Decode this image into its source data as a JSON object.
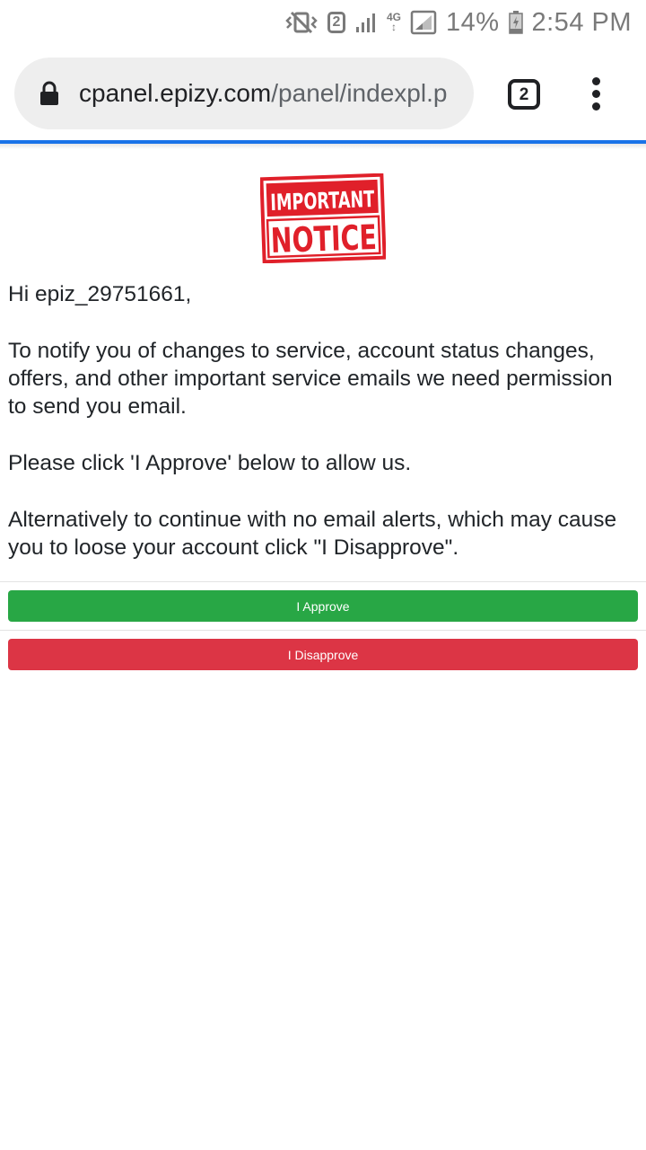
{
  "status_bar": {
    "sim_badge": "2",
    "network_type": "4G",
    "battery": "14%",
    "time": "2:54 PM",
    "icons": [
      "vibrate-icon",
      "sim-2-icon",
      "signal-icon",
      "network-4g-icon",
      "signal-2-icon",
      "battery-charging-icon"
    ]
  },
  "browser": {
    "url_host": "cpanel.epizy.com",
    "url_path": "/panel/indexpl.p",
    "tab_count": "2",
    "icons": [
      "lock-icon",
      "tab-switcher-icon",
      "overflow-menu-icon"
    ],
    "accent_color": "#1a73e8"
  },
  "notice": {
    "logo_line1": "IMPORTANT",
    "logo_line2": "NOTICE",
    "logo_color": "#e0202a",
    "greeting": "Hi epiz_29751661,",
    "paragraph1": "To notify you of changes to service, account status changes, offers, and other important service emails we need permission to send you email.",
    "paragraph2": "Please click 'I Approve' below to allow us.",
    "paragraph3": "Alternatively to continue with no email alerts, which may cause you to loose your account click \"I Disapprove\"."
  },
  "actions": {
    "approve_label": "I Approve",
    "approve_color": "#28a745",
    "disapprove_label": "I Disapprove",
    "disapprove_color": "#dc3545"
  }
}
